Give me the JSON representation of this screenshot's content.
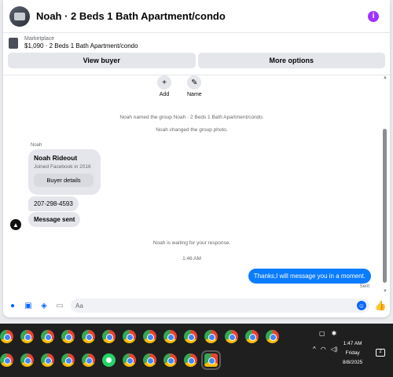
{
  "header": {
    "title": "Noah · 2 Beds 1 Bath Apartment/condo"
  },
  "listing": {
    "label": "Marketplace",
    "price_title": "$1,090 · 2 Beds 1 Bath Apartment/condo",
    "view_buyer": "View buyer",
    "more_options": "More options"
  },
  "actions": [
    {
      "label": "Add",
      "icon": "+"
    },
    {
      "label": "Name",
      "icon": "✎"
    }
  ],
  "system_messages": {
    "named": "Noah named the group Noah · 2 Beds 1 Bath Apartment/condo.",
    "photo": "Noah changed the group photo.",
    "waiting": "Noah is waiting for your response.",
    "time": "1:46 AM"
  },
  "incoming": {
    "sender": "Noah",
    "profile_name": "Noah Rideout",
    "joined": "Joined Facebook in 2016",
    "buyer_details": "Buyer details",
    "phone": "207-298-4593",
    "message_sent": "Message sent"
  },
  "outgoing": {
    "text": "Thanks,I will message you in a moment.",
    "status": "Sent"
  },
  "composer": {
    "placeholder": "Aa"
  },
  "taskbar": {
    "time": "1:47 AM",
    "day": "Friday",
    "date": "8/8/2025",
    "notifications": "2"
  },
  "colors": {
    "accent": "#0a7cff",
    "info": "#a033ff"
  }
}
